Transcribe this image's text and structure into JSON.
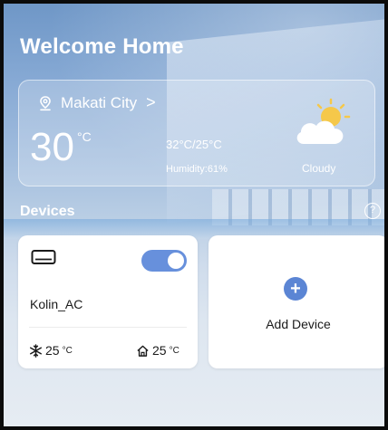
{
  "header": {
    "title": "Welcome Home"
  },
  "weather": {
    "location": "Makati City",
    "temperature": "30",
    "unit": "°C",
    "range": "32°C/25°C",
    "humidity": "Humidity:61%",
    "condition": "Cloudy",
    "icon": "partly-cloudy-icon"
  },
  "devices": {
    "section_title": "Devices",
    "help_icon": "?",
    "items": [
      {
        "name": "Kolin_AC",
        "icon": "air-conditioner-icon",
        "power_on": true,
        "set_temp": "25",
        "room_temp": "25",
        "temp_unit": "°C"
      }
    ],
    "add_label": "Add Device",
    "add_icon": "+"
  },
  "colors": {
    "accent": "#6790dc",
    "plus_button": "#5b85d4"
  }
}
